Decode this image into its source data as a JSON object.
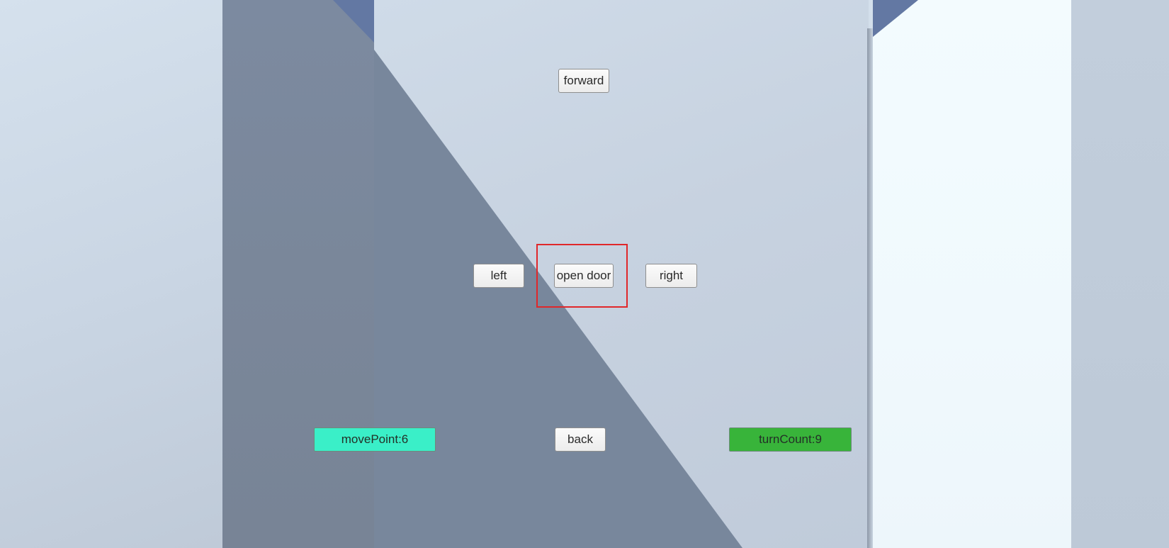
{
  "controls": {
    "forward_label": "forward",
    "left_label": "left",
    "open_door_label": "open door",
    "right_label": "right",
    "back_label": "back"
  },
  "stats": {
    "move_point_label": "movePoint:6",
    "move_point_value": 6,
    "turn_count_label": "turnCount:9",
    "turn_count_value": 9
  },
  "colors": {
    "move_point_bg": "#3aefc8",
    "turn_count_bg": "#38b43a",
    "highlight": "#e0272a",
    "shadow_wall": "#78879c",
    "accent_blue": "#6378a3"
  }
}
